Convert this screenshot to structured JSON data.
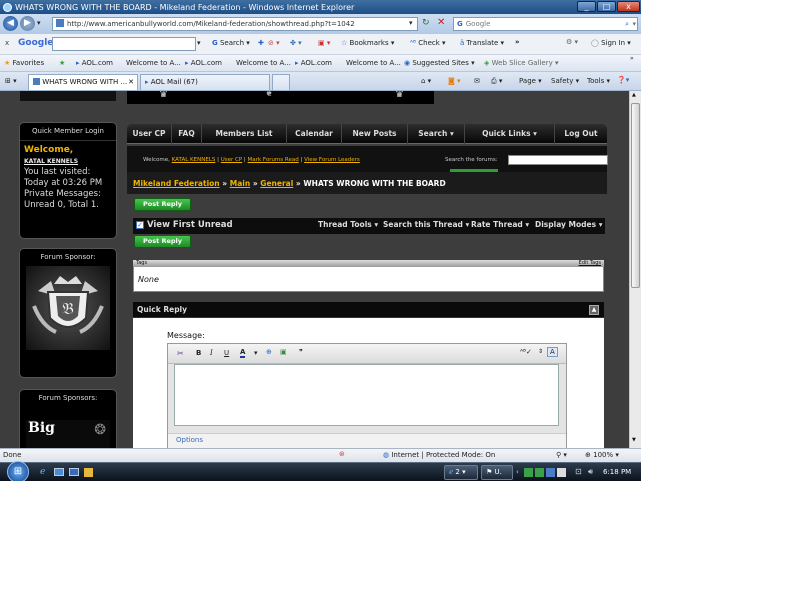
{
  "browser": {
    "title": "WHATS WRONG WITH THE BOARD - Mikeland Federation - Windows Internet Explorer",
    "url": "http://www.americanbullyworld.com/Mikeland-federation/showthread.php?t=1042",
    "search_placeholder": "Google",
    "win_controls": [
      "_",
      "□",
      "x"
    ]
  },
  "google_toolbar": {
    "close": "x",
    "brand": "Google",
    "search_label": "Search",
    "bookmarks_label": "Bookmarks",
    "check_label": "Check",
    "translate_label": "Translate",
    "more": "»",
    "signin_label": "Sign In"
  },
  "favorites_bar": {
    "favorites_label": "Favorites",
    "items": [
      "AOL.com",
      "Welcome to A...",
      "AOL.com",
      "Welcome to A...",
      "AOL.com",
      "Welcome to A...",
      "Suggested Sites",
      "Web Slice Gallery"
    ]
  },
  "tabs": {
    "items": [
      "WHATS WRONG WITH ...",
      "AOL Mail (67)"
    ],
    "tools": [
      "Page",
      "Safety",
      "Tools"
    ]
  },
  "sidebar": {
    "login_header": "Quick Member Login",
    "welcome": "Welcome,",
    "username": "KATAL KENNELS",
    "last_visited_label": "You last visited:",
    "last_visited_value": "Today at 03:26 PM",
    "pm_line": "Private Messages: Unread 0, Total 1.",
    "sponsor1_header": "Forum Sponsor:",
    "sponsor2_header": "Forum Sponsors:",
    "sponsor2_text": "Big"
  },
  "navbar": {
    "items": [
      "User CP",
      "FAQ",
      "Members List",
      "Calendar",
      "New Posts",
      "Search",
      "Quick Links",
      "Log Out"
    ]
  },
  "subnav": {
    "welcome_prefix": "Welcome,",
    "username": "KATAL KENNELS",
    "user_cp": "User CP",
    "mark_read": "Mark Forums Read",
    "view_leaders": "View Forum Leaders",
    "search_label": "Search the forums:"
  },
  "breadcrumb": {
    "items": [
      "Mikeland Federation",
      "Main",
      "General"
    ],
    "separator": "»",
    "current": "WHATS WRONG WITH THE BOARD"
  },
  "thread": {
    "post_reply": "Post Reply",
    "view_first_unread": "View First Unread",
    "tools": [
      "Thread Tools",
      "Search this Thread",
      "Rate Thread",
      "Display Modes"
    ],
    "tags_header": "Tags",
    "edit_tags": "Edit Tags",
    "tags_value": "None",
    "quick_reply_header": "Quick Reply",
    "message_label": "Message:",
    "options_label": "Options"
  },
  "statusbar": {
    "done": "Done",
    "zone": "Internet | Protected Mode: On",
    "zoom": "100%"
  },
  "taskbar": {
    "ie_windows": "2",
    "clock": "6:18 PM"
  }
}
